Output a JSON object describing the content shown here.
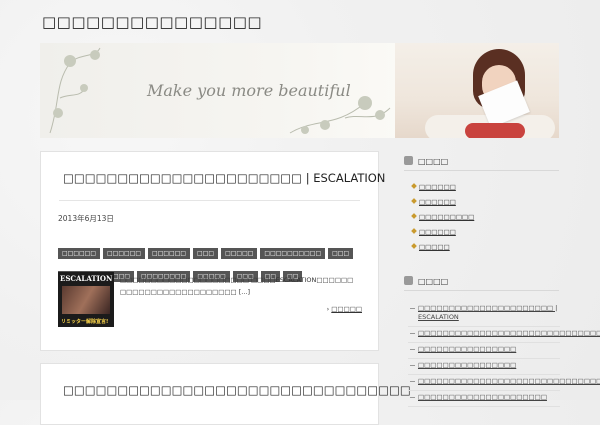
{
  "site": {
    "title": "□□□□□□□□□□□□□□□"
  },
  "banner": {
    "slogan": "Make you more beautiful"
  },
  "posts": [
    {
      "title": "□□□□□□□□□□□□□□□□□□□□□□ | ESCALATION",
      "date": "2013年6月13日",
      "tags": [
        "□□□□□□",
        "□□□□□□",
        "□□□□□□",
        "□□□",
        "□□□□□",
        "□□□□□□□□□□",
        "□□□",
        "□□□□□□□□□□□□",
        "□□□□□□□□",
        "□□□□□",
        "□□□",
        "□□",
        "□□"
      ],
      "thumb": {
        "brand": "ESCALATION",
        "caption": "リミッター解除宣言!"
      },
      "excerpt": "□□□□□□□□□□□□□□□□□□□□□ □□□□ESCALATION□□□□□□ □□□□□□□□□□□□□□□□□□□ [...]",
      "more_label": "□□□□□"
    },
    {
      "title": "□□□□□□□□□□□□□□□□□□□□□□□□□□□□□□□□"
    }
  ],
  "sidebar": {
    "categories_title": "□□□□",
    "categories": [
      "□□□□□□",
      "□□□□□□",
      "□□□□□□□□□",
      "□□□□□□",
      "□□□□□"
    ],
    "recent_title": "□□□□",
    "recent": [
      "□□□□□□□□□□□□□□□□□□□□□□ | ESCALATION",
      "□□□□□□□□□□□□□□□□□□□□□□□□□□□□□□□",
      "□□□□□□□□□□□□□□□□",
      "□□□□□□□□□□□□□□□□",
      "□□□□□□□□□□□□□□□□□□□□□□□□□□□□□□□",
      "□□□□□□□□□□□□□□□□□□□□□"
    ]
  },
  "colors": {
    "tag_bg": "#555555",
    "accent_bullet": "#c99a2e",
    "page_bg": "#f1f1f1"
  }
}
